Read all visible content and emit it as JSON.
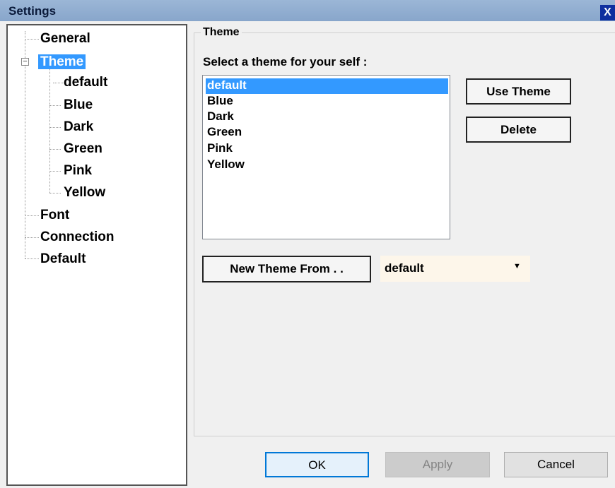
{
  "window": {
    "title": "Settings",
    "close_label": "X"
  },
  "tree": {
    "items": [
      {
        "label": "General"
      },
      {
        "label": "Theme"
      },
      {
        "label": "default"
      },
      {
        "label": "Blue"
      },
      {
        "label": "Dark"
      },
      {
        "label": "Green"
      },
      {
        "label": "Pink"
      },
      {
        "label": "Yellow"
      },
      {
        "label": "Font"
      },
      {
        "label": "Connection"
      },
      {
        "label": "Default"
      }
    ],
    "selected": "Theme",
    "expander_glyph": "−"
  },
  "theme_panel": {
    "group_title": "Theme",
    "select_label": "Select a theme for your self :",
    "themes": [
      "default",
      "Blue",
      "Dark",
      "Green",
      "Pink",
      "Yellow"
    ],
    "selected_theme": "default",
    "use_theme_label": "Use Theme",
    "delete_label": "Delete",
    "new_theme_label": "New Theme From . .",
    "new_theme_base": "default",
    "dropdown_arrow": "▼"
  },
  "footer": {
    "ok_label": "OK",
    "apply_label": "Apply",
    "cancel_label": "Cancel"
  },
  "colors": {
    "selection": "#3399ff",
    "title_bar": "#88a6cb",
    "close_button": "#0f2f9f",
    "ok_border": "#0078d7"
  }
}
